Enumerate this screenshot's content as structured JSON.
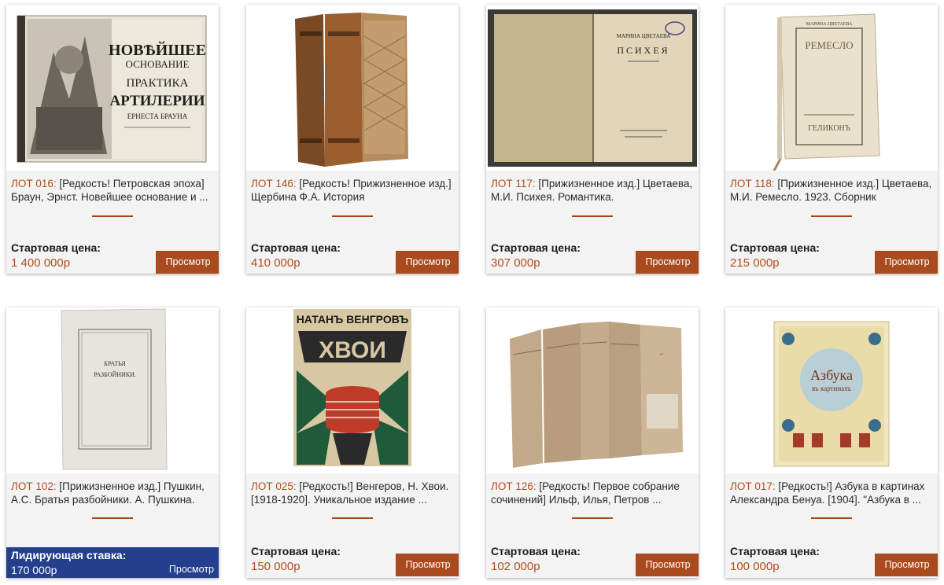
{
  "lots": [
    {
      "lot": "ЛОТ 016:",
      "title": "[Редкость! Петровская эпоха] Браун, Эрнст. Новейшее основание и ...",
      "price_label": "Стартовая цена:",
      "price": "1 400 000р",
      "button": "Просмотр",
      "cover_text": [
        "НОВѢЙШЕЕ",
        "ОСНОВАНИЕ",
        "ПРАКТИКА",
        "АРТИЛЕРИИ",
        "ЕРНЕСТА БРАУНА"
      ]
    },
    {
      "lot": "ЛОТ 146:",
      "title": "[Редкость! Прижизненное изд.] Щербина Ф.А. История",
      "price_label": "Стартовая цена:",
      "price": "410 000р",
      "button": "Просмотр"
    },
    {
      "lot": "ЛОТ 117:",
      "title": "[Прижизненное изд.] Цветаева, М.И. Психея. Романтика.",
      "price_label": "Стартовая цена:",
      "price": "307 000р",
      "button": "Просмотр",
      "cover_text": [
        "МАРИНА ЦВЕТАЕВА",
        "ПСИХЕЯ"
      ]
    },
    {
      "lot": "ЛОТ 118:",
      "title": "[Прижизненное изд.] Цветаева, М.И. Ремесло. 1923. Сборник",
      "price_label": "Стартовая цена:",
      "price": "215 000р",
      "button": "Просмотр",
      "cover_text": [
        "МАРИНА ЦВЕТАЕВА",
        "РЕМЕСЛО",
        "ГЕЛИКОНЪ"
      ]
    },
    {
      "lot": "ЛОТ 102:",
      "title": "[Прижизненное изд.] Пушкин, А.С. Братья разбойники. А. Пушкина.",
      "leading_label": "Лидирующая ставка:",
      "price": "170 000р",
      "button": "Просмотр",
      "cover_text": [
        "БРАТЬЯ",
        "РАЗБОЙНИКИ."
      ]
    },
    {
      "lot": "ЛОТ 025:",
      "title": "[Редкость!] Венгеров, Н. Хвои. [1918-1920]. Уникальное издание ...",
      "price_label": "Стартовая цена:",
      "price": "150 000р",
      "button": "Просмотр",
      "cover_text": [
        "НАТАНЪ ВЕНГРОВЪ",
        "ХВОИ"
      ]
    },
    {
      "lot": "ЛОТ 126:",
      "title": "[Редкость! Первое собрание сочинений] Ильф, Илья, Петров ...",
      "price_label": "Стартовая цена:",
      "price": "102 000р",
      "button": "Просмотр"
    },
    {
      "lot": "ЛОТ 017:",
      "title": "[Редкость!] Азбука в картинах Александра Бенуа. [1904]. \"Азбука в ...",
      "price_label": "Стартовая цена:",
      "price": "100 000р",
      "button": "Просмотр",
      "cover_text": [
        "Азбука",
        "въ картинахъ"
      ]
    }
  ],
  "colors": {
    "accent": "#a94b1e",
    "lot_number": "#b34d1e",
    "leading_bg": "#243f8c"
  }
}
